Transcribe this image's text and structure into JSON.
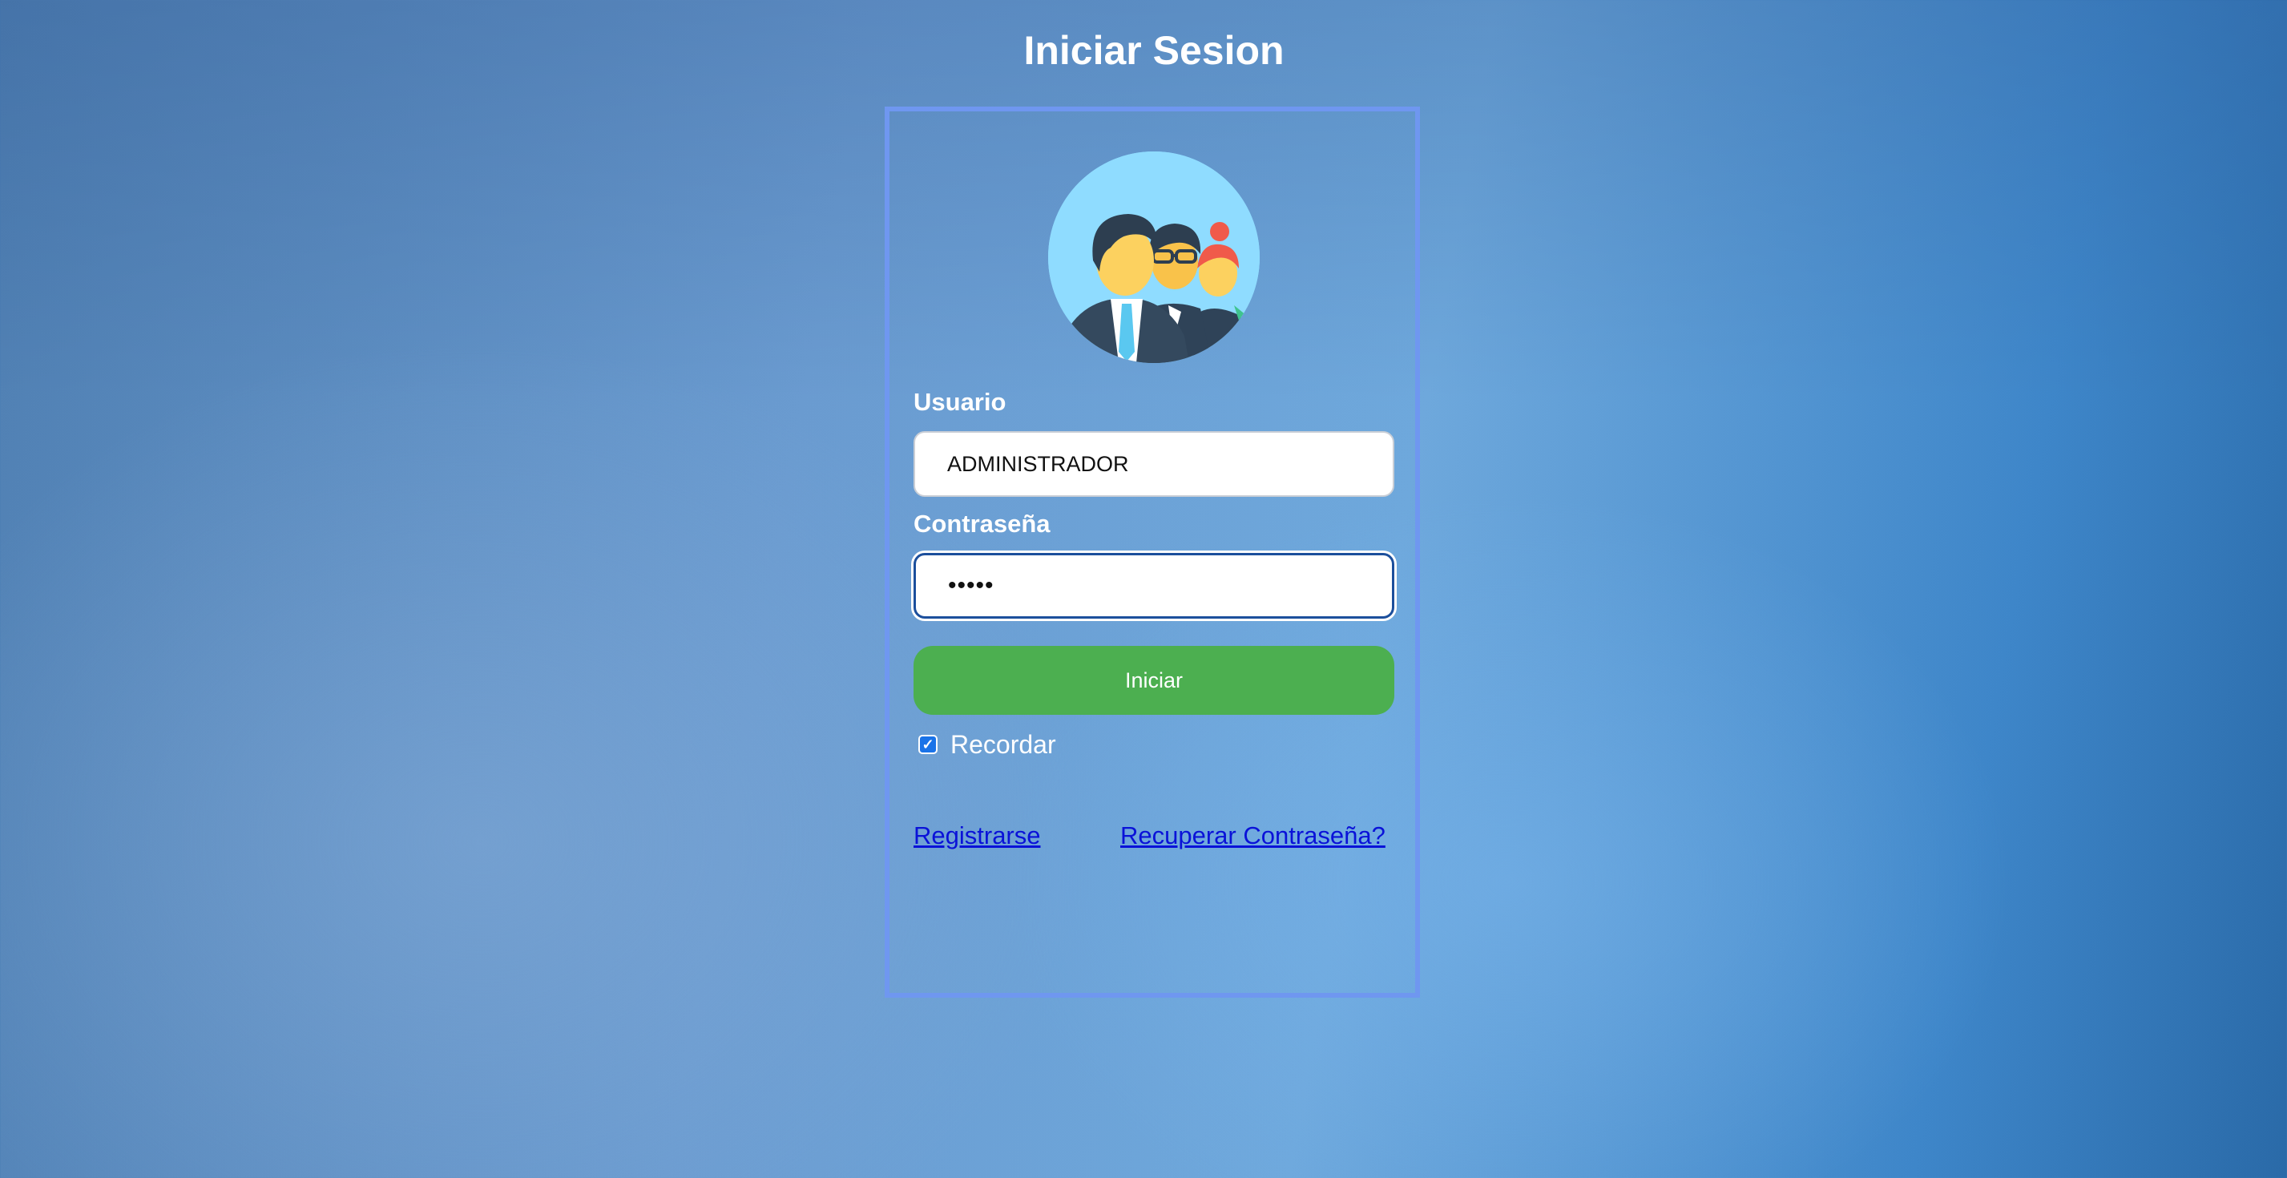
{
  "page": {
    "title": "Iniciar Sesion"
  },
  "form": {
    "avatar_icon": "team-avatar-icon",
    "username_label": "Usuario",
    "username_value": "ADMINISTRADOR",
    "password_label": "Contraseña",
    "password_value": "•••••",
    "submit_label": "Iniciar",
    "remember_label": "Recordar",
    "remember_checked": true
  },
  "links": {
    "register": "Registrarse",
    "recover": "Recuperar Contraseña?"
  },
  "colors": {
    "card_border": "#6f97f0",
    "submit_button": "#4caf50",
    "link": "#0a12d8",
    "avatar_bg": "#8fdcff"
  }
}
